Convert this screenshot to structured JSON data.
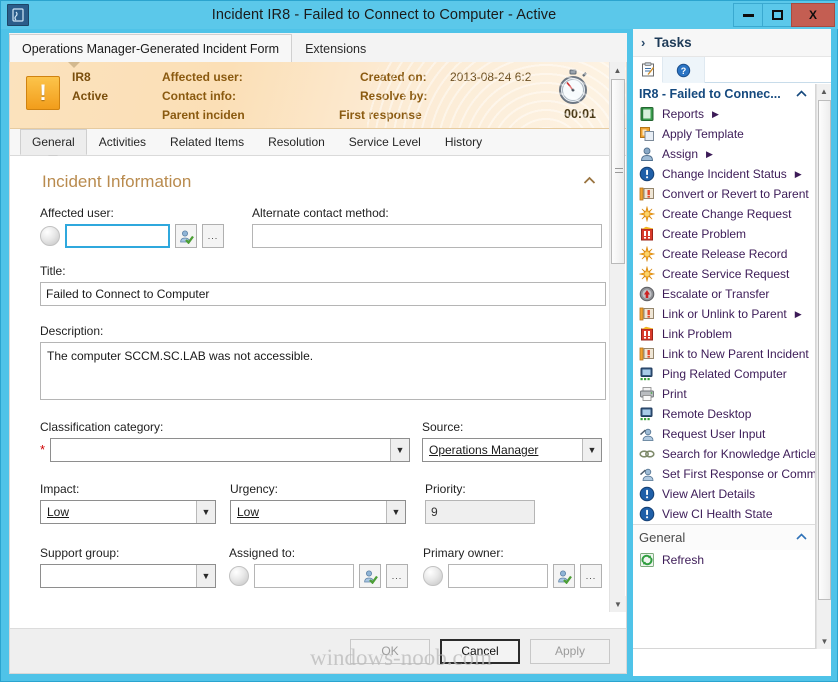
{
  "window": {
    "title": "Incident IR8 - Failed to Connect to Computer - Active",
    "app_icon": "service-manager-icon",
    "minimize_label": "Minimize",
    "maximize_label": "Maximize",
    "close_label": "X"
  },
  "form_tabs": [
    {
      "label": "Operations Manager-Generated Incident Form",
      "active": true
    },
    {
      "label": "Extensions",
      "active": false
    }
  ],
  "banner": {
    "id": "IR8",
    "status": "Active",
    "labels": {
      "affected_user": "Affected user:",
      "contact_info": "Contact info:",
      "parent_incident": "Parent inciden",
      "created_on": "Created on:",
      "resolve_by": "Resolve by:",
      "first_response": "First response"
    },
    "created_on_value": "2013-08-24 6:2",
    "resolve_by_value": "",
    "timer": "00:01",
    "severity_glyph": "!"
  },
  "inner_tabs": [
    {
      "label": "General",
      "active": true
    },
    {
      "label": "Activities",
      "active": false
    },
    {
      "label": "Related Items",
      "active": false
    },
    {
      "label": "Resolution",
      "active": false
    },
    {
      "label": "Service Level",
      "active": false
    },
    {
      "label": "History",
      "active": false
    }
  ],
  "section": {
    "title": "Incident Information",
    "collapse_chevron": "⌃"
  },
  "fields": {
    "affected_user": {
      "label": "Affected user:",
      "value": "",
      "placeholder": ""
    },
    "alternate_contact_method": {
      "label": "Alternate contact method:",
      "value": "",
      "placeholder": ""
    },
    "title": {
      "label": "Title:",
      "value": "Failed to Connect to Computer"
    },
    "description": {
      "label": "Description:",
      "value": "The computer SCCM.SC.LAB was not accessible."
    },
    "classification_category": {
      "label": "Classification category:",
      "value": "",
      "required": "*"
    },
    "source": {
      "label": "Source:",
      "value": "Operations Manager"
    },
    "impact": {
      "label": "Impact:",
      "value": "Low"
    },
    "urgency": {
      "label": "Urgency:",
      "value": "Low"
    },
    "priority": {
      "label": "Priority:",
      "value": "9"
    },
    "support_group": {
      "label": "Support group:",
      "value": ""
    },
    "assigned_to": {
      "label": "Assigned to:",
      "value": ""
    },
    "primary_owner": {
      "label": "Primary owner:",
      "value": ""
    }
  },
  "footer_buttons": {
    "ok": "OK",
    "cancel": "Cancel",
    "apply": "Apply"
  },
  "watermark": "windows-noob.com",
  "tasks_pane": {
    "header_title": "Tasks",
    "header_chevron": "›",
    "tab_icons": [
      "clipboard-tasks-icon",
      "help-info-icon"
    ],
    "groups": [
      {
        "title": "IR8 - Failed to Connec...",
        "chevron": "⌃",
        "items": [
          {
            "label": "Reports",
            "icon": "report-book-icon",
            "submenu": true
          },
          {
            "label": "Apply Template",
            "icon": "template-icon",
            "submenu": false
          },
          {
            "label": "Assign",
            "icon": "user-assign-icon",
            "submenu": true
          },
          {
            "label": "Change Incident Status",
            "icon": "incident-status-icon",
            "submenu": true
          },
          {
            "label": "Convert or Revert to Parent",
            "icon": "convert-parent-icon",
            "submenu": false
          },
          {
            "label": "Create Change Request",
            "icon": "starburst-icon",
            "submenu": false
          },
          {
            "label": "Create Problem",
            "icon": "problem-icon",
            "submenu": false
          },
          {
            "label": "Create Release Record",
            "icon": "starburst-icon",
            "submenu": false
          },
          {
            "label": "Create Service Request",
            "icon": "starburst-icon",
            "submenu": false
          },
          {
            "label": "Escalate or Transfer",
            "icon": "escalate-arrow-icon",
            "submenu": false
          },
          {
            "label": "Link or Unlink to Parent",
            "icon": "convert-parent-icon",
            "submenu": true
          },
          {
            "label": "Link Problem",
            "icon": "problem-icon",
            "submenu": false
          },
          {
            "label": "Link to New Parent Incident",
            "icon": "convert-parent-icon",
            "submenu": false
          },
          {
            "label": "Ping Related Computer",
            "icon": "computer-network-icon",
            "submenu": false
          },
          {
            "label": "Print",
            "icon": "printer-icon",
            "submenu": false
          },
          {
            "label": "Remote Desktop",
            "icon": "computer-network-icon",
            "submenu": false
          },
          {
            "label": "Request User Input",
            "icon": "user-input-icon",
            "submenu": false
          },
          {
            "label": "Search for Knowledge Articles",
            "icon": "link-chain-icon",
            "submenu": false
          },
          {
            "label": "Set First Response or Commer",
            "icon": "user-input-icon",
            "submenu": false
          },
          {
            "label": "View Alert Details",
            "icon": "incident-status-icon",
            "submenu": false
          },
          {
            "label": "View CI Health State",
            "icon": "incident-status-icon",
            "submenu": false
          }
        ]
      },
      {
        "title": "General",
        "chevron": "⌃",
        "items": [
          {
            "label": "Refresh",
            "icon": "refresh-icon",
            "submenu": false
          }
        ]
      }
    ]
  }
}
